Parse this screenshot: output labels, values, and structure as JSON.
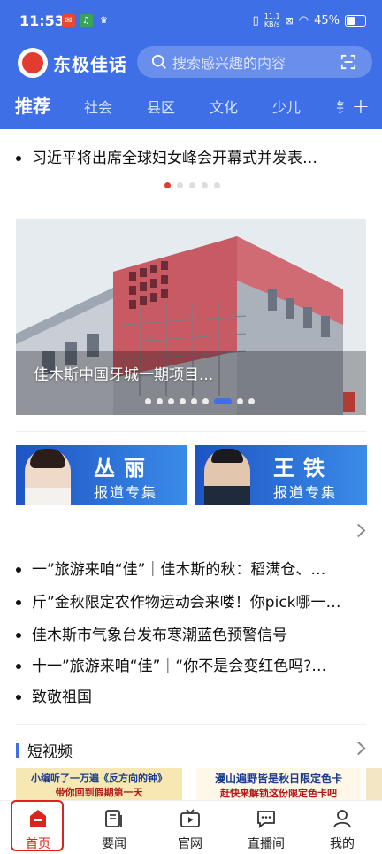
{
  "status": {
    "time": "11:53",
    "speed_top": "11.1",
    "speed_bottom": "KB/s",
    "battery": "45%"
  },
  "app": {
    "logo_text": "东极佳话"
  },
  "search": {
    "placeholder": "搜索感兴趣的内容"
  },
  "tabs": [
    "推荐",
    "社会",
    "县区",
    "文化",
    "少儿"
  ],
  "headline": "习近平将出席全球妇女峰会开幕式并发表…",
  "carousel": {
    "caption": "佳木斯中国牙城一期项目..."
  },
  "banners": [
    {
      "name": "丛丽",
      "sub": "报道专集"
    },
    {
      "name": "王铁",
      "sub": "报道专集"
    }
  ],
  "news": [
    "一”旅游来咱“佳”｜佳木斯的秋：稻满仓、…",
    "斤”金秋限定农作物运动会来喽！你pick哪一…",
    "佳木斯市气象台发布寒潮蓝色预警信号",
    "十一”旅游来咱“佳”｜“你不是会变红色吗?…",
    "致敬祖国"
  ],
  "section": {
    "title": "短视频"
  },
  "thumbs": [
    {
      "line1": "小编听了一万遍《反方向的钟》",
      "line2": "带你回到假期第一天"
    },
    {
      "line1": "漫山遍野皆是秋日限定色卡",
      "line2": "赶快来解锁这份限定色卡吧"
    }
  ],
  "bottom_nav": [
    "首页",
    "要闻",
    "官网",
    "直播间",
    "我的"
  ],
  "colors": {
    "brand_blue": "#3f6fe6",
    "accent_red": "#e23b2f"
  }
}
